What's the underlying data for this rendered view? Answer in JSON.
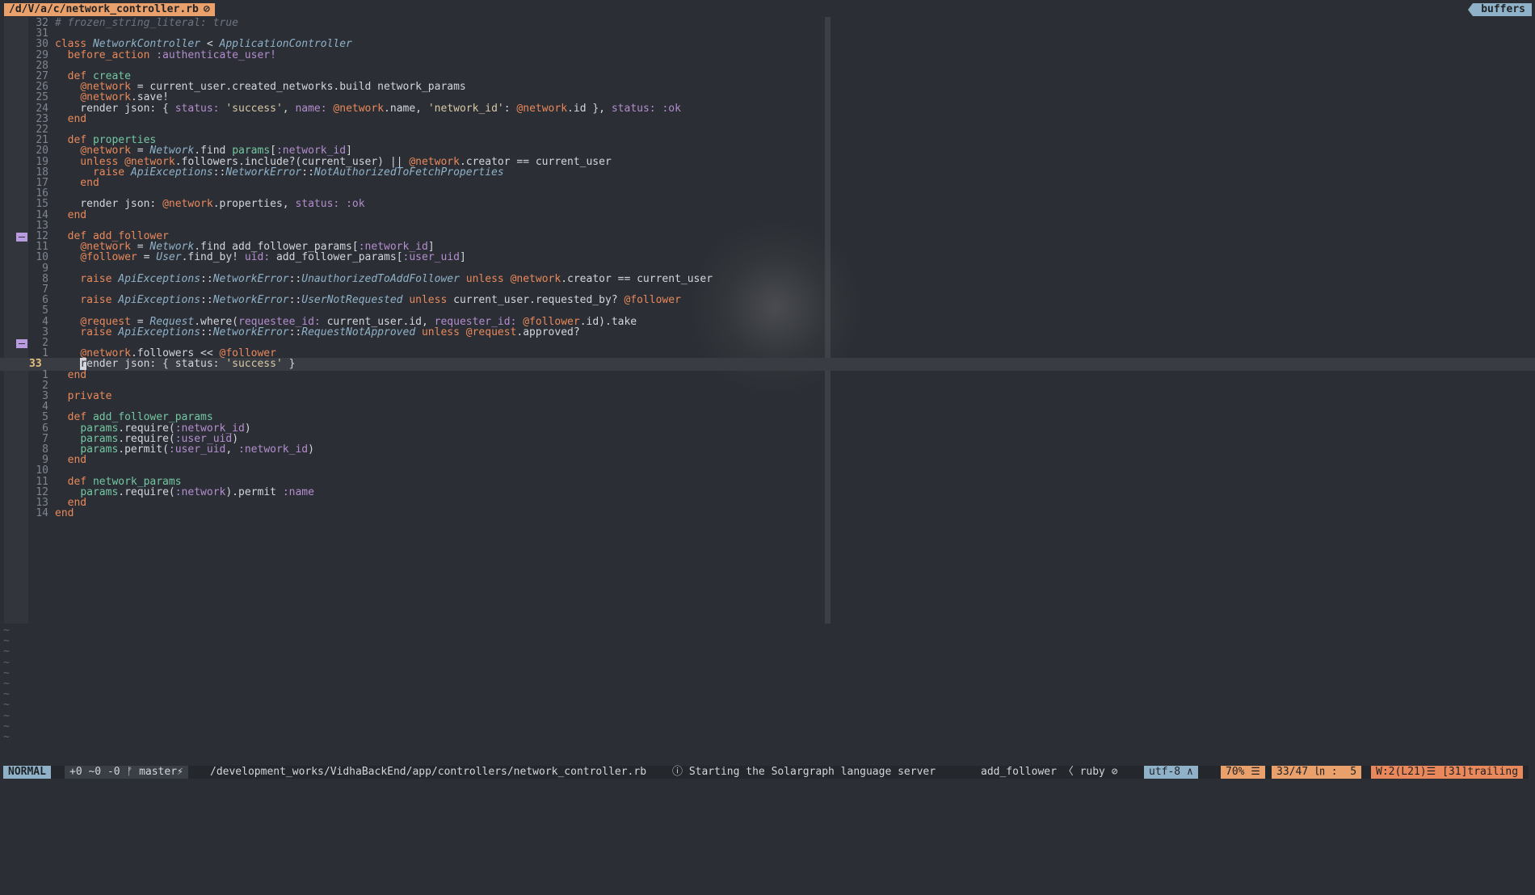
{
  "tabline": {
    "active_tab": "/d/V/a/c/network_controller.rb",
    "active_tab_icon": "lock-icon",
    "right_label": "buffers"
  },
  "editor": {
    "cursor_line": "33",
    "lines": [
      {
        "ln": "32",
        "segs": [
          {
            "t": "# frozen_string_literal: true",
            "c": "cm"
          }
        ]
      },
      {
        "ln": "31",
        "segs": []
      },
      {
        "ln": "30",
        "segs": [
          {
            "t": "class ",
            "c": "kw"
          },
          {
            "t": "NetworkController",
            "c": "cls"
          },
          {
            "t": " < ",
            "c": ""
          },
          {
            "t": "ApplicationController",
            "c": "cls"
          }
        ]
      },
      {
        "ln": "29",
        "segs": [
          {
            "t": "  before_action ",
            "c": "kw"
          },
          {
            "t": ":authenticate_user!",
            "c": "sym"
          }
        ]
      },
      {
        "ln": "28",
        "segs": []
      },
      {
        "ln": "27",
        "segs": [
          {
            "t": "  def ",
            "c": "def"
          },
          {
            "t": "create",
            "c": "fn"
          }
        ]
      },
      {
        "ln": "26",
        "segs": [
          {
            "t": "    ",
            "c": ""
          },
          {
            "t": "@network",
            "c": "ivar"
          },
          {
            "t": " = current_user.created_networks.build network_params",
            "c": ""
          }
        ]
      },
      {
        "ln": "25",
        "segs": [
          {
            "t": "    ",
            "c": ""
          },
          {
            "t": "@network",
            "c": "ivar"
          },
          {
            "t": ".save!",
            "c": ""
          }
        ]
      },
      {
        "ln": "24",
        "segs": [
          {
            "t": "    render json: { ",
            "c": ""
          },
          {
            "t": "status:",
            "c": "sym"
          },
          {
            "t": " ",
            "c": ""
          },
          {
            "t": "'success'",
            "c": "str"
          },
          {
            "t": ", ",
            "c": ""
          },
          {
            "t": "name:",
            "c": "sym"
          },
          {
            "t": " ",
            "c": ""
          },
          {
            "t": "@network",
            "c": "ivar"
          },
          {
            "t": ".name, ",
            "c": ""
          },
          {
            "t": "'network_id'",
            "c": "str"
          },
          {
            "t": ": ",
            "c": ""
          },
          {
            "t": "@network",
            "c": "ivar"
          },
          {
            "t": ".id }, ",
            "c": ""
          },
          {
            "t": "status:",
            "c": "sym"
          },
          {
            "t": " ",
            "c": ""
          },
          {
            "t": ":ok",
            "c": "sym"
          }
        ]
      },
      {
        "ln": "23",
        "segs": [
          {
            "t": "  end",
            "c": "kw"
          }
        ]
      },
      {
        "ln": "22",
        "segs": []
      },
      {
        "ln": "21",
        "segs": [
          {
            "t": "  def ",
            "c": "def"
          },
          {
            "t": "properties",
            "c": "fn"
          }
        ]
      },
      {
        "ln": "20",
        "segs": [
          {
            "t": "    ",
            "c": ""
          },
          {
            "t": "@network",
            "c": "ivar"
          },
          {
            "t": " = ",
            "c": ""
          },
          {
            "t": "Network",
            "c": "cls"
          },
          {
            "t": ".find ",
            "c": ""
          },
          {
            "t": "params",
            "c": "prm"
          },
          {
            "t": "[",
            "c": ""
          },
          {
            "t": ":network_id",
            "c": "sym"
          },
          {
            "t": "]",
            "c": ""
          }
        ]
      },
      {
        "ln": "19",
        "segs": [
          {
            "t": "    unless ",
            "c": "kw"
          },
          {
            "t": "@network",
            "c": "ivar"
          },
          {
            "t": ".followers.include?(current_user) || ",
            "c": ""
          },
          {
            "t": "@network",
            "c": "ivar"
          },
          {
            "t": ".creator == current_user",
            "c": ""
          }
        ]
      },
      {
        "ln": "18",
        "segs": [
          {
            "t": "      raise ",
            "c": "kw"
          },
          {
            "t": "ApiExceptions",
            "c": "cls"
          },
          {
            "t": "::",
            "c": ""
          },
          {
            "t": "NetworkError",
            "c": "cls"
          },
          {
            "t": "::",
            "c": ""
          },
          {
            "t": "NotAuthorizedToFetchProperties",
            "c": "cls"
          }
        ]
      },
      {
        "ln": "17",
        "segs": [
          {
            "t": "    end",
            "c": "kw"
          }
        ]
      },
      {
        "ln": "16",
        "segs": []
      },
      {
        "ln": "15",
        "segs": [
          {
            "t": "    render json: ",
            "c": ""
          },
          {
            "t": "@network",
            "c": "ivar"
          },
          {
            "t": ".properties, ",
            "c": ""
          },
          {
            "t": "status:",
            "c": "sym"
          },
          {
            "t": " ",
            "c": ""
          },
          {
            "t": ":ok",
            "c": "sym"
          }
        ]
      },
      {
        "ln": "14",
        "segs": [
          {
            "t": "  end",
            "c": "kw"
          }
        ]
      },
      {
        "ln": "13",
        "segs": []
      },
      {
        "ln": "12",
        "mark": true,
        "segs": [
          {
            "t": "  def ",
            "c": "def"
          },
          {
            "t": "add_follower",
            "c": "kw"
          }
        ]
      },
      {
        "ln": "11",
        "segs": [
          {
            "t": "    ",
            "c": ""
          },
          {
            "t": "@network",
            "c": "ivar"
          },
          {
            "t": " = ",
            "c": ""
          },
          {
            "t": "Network",
            "c": "cls"
          },
          {
            "t": ".find add_follower_params[",
            "c": ""
          },
          {
            "t": ":network_id",
            "c": "sym"
          },
          {
            "t": "]",
            "c": ""
          }
        ]
      },
      {
        "ln": "10",
        "segs": [
          {
            "t": "    ",
            "c": ""
          },
          {
            "t": "@follower",
            "c": "ivar"
          },
          {
            "t": " = ",
            "c": ""
          },
          {
            "t": "User",
            "c": "cls"
          },
          {
            "t": ".find_by! ",
            "c": ""
          },
          {
            "t": "uid:",
            "c": "sym"
          },
          {
            "t": " add_follower_params[",
            "c": ""
          },
          {
            "t": ":user_uid",
            "c": "sym"
          },
          {
            "t": "]",
            "c": ""
          }
        ]
      },
      {
        "ln": "9",
        "segs": []
      },
      {
        "ln": "8",
        "segs": [
          {
            "t": "    raise ",
            "c": "kw"
          },
          {
            "t": "ApiExceptions",
            "c": "cls"
          },
          {
            "t": "::",
            "c": ""
          },
          {
            "t": "NetworkError",
            "c": "cls"
          },
          {
            "t": "::",
            "c": ""
          },
          {
            "t": "UnauthorizedToAddFollower",
            "c": "cls"
          },
          {
            "t": " unless ",
            "c": "kw"
          },
          {
            "t": "@network",
            "c": "ivar"
          },
          {
            "t": ".creator == current_user",
            "c": ""
          }
        ]
      },
      {
        "ln": "7",
        "segs": []
      },
      {
        "ln": "6",
        "segs": [
          {
            "t": "    raise ",
            "c": "kw"
          },
          {
            "t": "ApiExceptions",
            "c": "cls"
          },
          {
            "t": "::",
            "c": ""
          },
          {
            "t": "NetworkError",
            "c": "cls"
          },
          {
            "t": "::",
            "c": ""
          },
          {
            "t": "UserNotRequested",
            "c": "cls"
          },
          {
            "t": " unless ",
            "c": "kw"
          },
          {
            "t": "current_user.requested_by? ",
            "c": ""
          },
          {
            "t": "@follower",
            "c": "ivar"
          }
        ]
      },
      {
        "ln": "5",
        "segs": []
      },
      {
        "ln": "4",
        "segs": [
          {
            "t": "    ",
            "c": ""
          },
          {
            "t": "@request",
            "c": "ivar"
          },
          {
            "t": " = ",
            "c": ""
          },
          {
            "t": "Request",
            "c": "cls"
          },
          {
            "t": ".where(",
            "c": ""
          },
          {
            "t": "requestee_id:",
            "c": "sym"
          },
          {
            "t": " current_user.id, ",
            "c": ""
          },
          {
            "t": "requester_id:",
            "c": "sym"
          },
          {
            "t": " ",
            "c": ""
          },
          {
            "t": "@follower",
            "c": "ivar"
          },
          {
            "t": ".id).take",
            "c": ""
          }
        ]
      },
      {
        "ln": "3",
        "segs": [
          {
            "t": "    raise ",
            "c": "kw"
          },
          {
            "t": "ApiExceptions",
            "c": "cls"
          },
          {
            "t": "::",
            "c": ""
          },
          {
            "t": "NetworkError",
            "c": "cls"
          },
          {
            "t": "::",
            "c": ""
          },
          {
            "t": "RequestNotApproved",
            "c": "cls"
          },
          {
            "t": " unless ",
            "c": "kw"
          },
          {
            "t": "@request",
            "c": "ivar"
          },
          {
            "t": ".approved?",
            "c": ""
          }
        ]
      },
      {
        "ln": "2",
        "mark": true,
        "segs": []
      },
      {
        "ln": "1",
        "segs": [
          {
            "t": "    ",
            "c": ""
          },
          {
            "t": "@network",
            "c": "ivar"
          },
          {
            "t": ".followers << ",
            "c": ""
          },
          {
            "t": "@follower",
            "c": "ivar"
          }
        ]
      },
      {
        "ln": "33",
        "cur": true,
        "segs": [
          {
            "t": "    ",
            "c": ""
          },
          {
            "t": "r",
            "c": "cursor"
          },
          {
            "t": "ender json: { status: ",
            "c": ""
          },
          {
            "t": "'success'",
            "c": "str"
          },
          {
            "t": " }",
            "c": ""
          }
        ]
      },
      {
        "ln": "1",
        "segs": [
          {
            "t": "  end",
            "c": "kw"
          }
        ]
      },
      {
        "ln": "2",
        "segs": []
      },
      {
        "ln": "3",
        "segs": [
          {
            "t": "  private",
            "c": "kw"
          }
        ]
      },
      {
        "ln": "4",
        "segs": []
      },
      {
        "ln": "5",
        "segs": [
          {
            "t": "  def ",
            "c": "def"
          },
          {
            "t": "add_follower_params",
            "c": "fn"
          }
        ]
      },
      {
        "ln": "6",
        "segs": [
          {
            "t": "    ",
            "c": ""
          },
          {
            "t": "params",
            "c": "prm"
          },
          {
            "t": ".require(",
            "c": ""
          },
          {
            "t": ":network_id",
            "c": "sym"
          },
          {
            "t": ")",
            "c": ""
          }
        ]
      },
      {
        "ln": "7",
        "segs": [
          {
            "t": "    ",
            "c": ""
          },
          {
            "t": "params",
            "c": "prm"
          },
          {
            "t": ".require(",
            "c": ""
          },
          {
            "t": ":user_uid",
            "c": "sym"
          },
          {
            "t": ")",
            "c": ""
          }
        ]
      },
      {
        "ln": "8",
        "segs": [
          {
            "t": "    ",
            "c": ""
          },
          {
            "t": "params",
            "c": "prm"
          },
          {
            "t": ".permit(",
            "c": ""
          },
          {
            "t": ":user_uid",
            "c": "sym"
          },
          {
            "t": ", ",
            "c": ""
          },
          {
            "t": ":network_id",
            "c": "sym"
          },
          {
            "t": ")",
            "c": ""
          }
        ]
      },
      {
        "ln": "9",
        "segs": [
          {
            "t": "  end",
            "c": "kw"
          }
        ]
      },
      {
        "ln": "10",
        "segs": []
      },
      {
        "ln": "11",
        "segs": [
          {
            "t": "  def ",
            "c": "def"
          },
          {
            "t": "network_params",
            "c": "fn"
          }
        ]
      },
      {
        "ln": "12",
        "segs": [
          {
            "t": "    ",
            "c": ""
          },
          {
            "t": "params",
            "c": "prm"
          },
          {
            "t": ".require(",
            "c": ""
          },
          {
            "t": ":network",
            "c": "sym"
          },
          {
            "t": ").permit ",
            "c": ""
          },
          {
            "t": ":name",
            "c": "sym"
          }
        ]
      },
      {
        "ln": "13",
        "segs": [
          {
            "t": "  end",
            "c": "kw"
          }
        ]
      },
      {
        "ln": "14",
        "segs": [
          {
            "t": "end",
            "c": "kw"
          }
        ]
      }
    ],
    "empty_line_marker": "~",
    "empty_line_count": 11
  },
  "statusline": {
    "mode": "NORMAL",
    "git": "+0 ~0 -0 ᚠ master⚡",
    "path": "/development_works/VidhaBackEnd/app/controllers/network_controller.rb",
    "message": "Starting the Solargraph language server",
    "message_icon": "info-icon",
    "function": "add_follower",
    "filetype": "ruby",
    "encoding": "utf-8 ∧",
    "percent": "70% ☰",
    "position": "33/47 ㏑ :  5",
    "warnings": "W:2(L21)☰ [31]trailing"
  },
  "colors": {
    "background": "#2b2e34",
    "accent_orange": "#e9a06b",
    "accent_blue": "#8fb2c9",
    "git_mark": "#b99be0"
  }
}
